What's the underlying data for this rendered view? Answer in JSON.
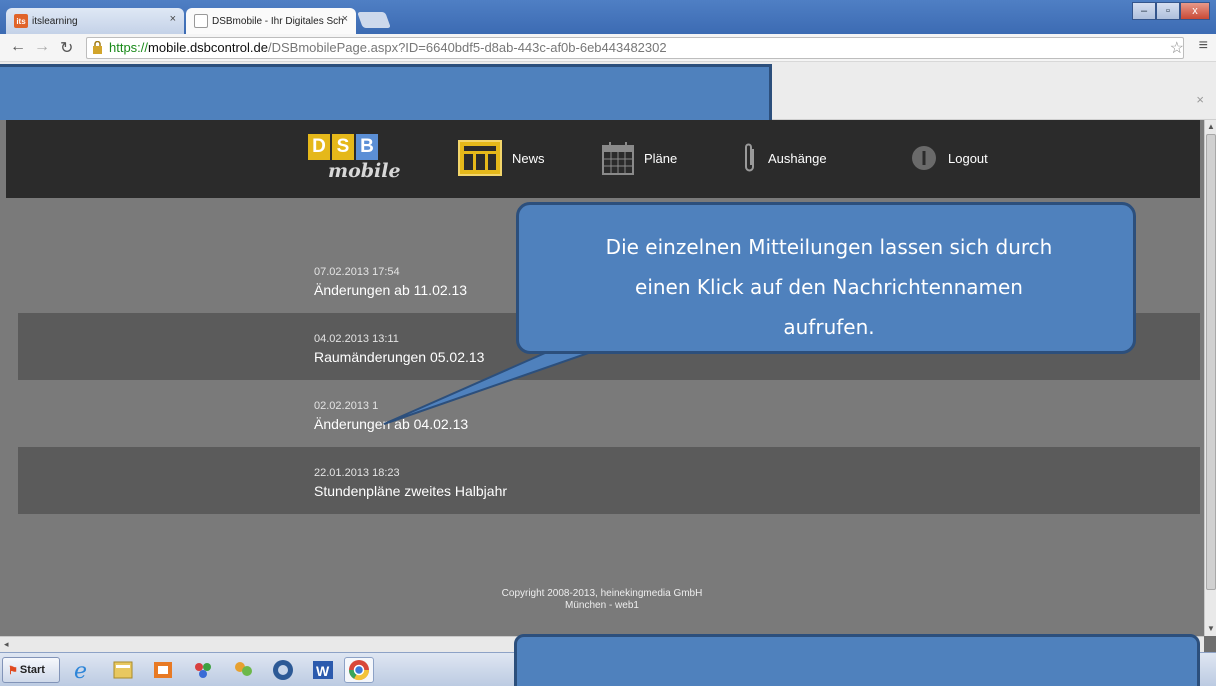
{
  "browser": {
    "tabs": [
      {
        "label": "itslearning",
        "icon": "its-favicon"
      },
      {
        "label": "DSBmobile - Ihr Digitales Sch",
        "icon": "page-favicon"
      }
    ],
    "address": {
      "protocol": "https://",
      "host": "mobile.dsbcontrol.de",
      "path": "/DSBmobilePage.aspx?ID=6640bdf5-d8ab-443c-af0b-6eb443482302"
    }
  },
  "nav": {
    "logo_letters": [
      "D",
      "S",
      "B"
    ],
    "logo_sub": "mobile",
    "items": [
      {
        "label": "News",
        "icon": "news-icon"
      },
      {
        "label": "Pläne",
        "icon": "calendar-icon"
      },
      {
        "label": "Aushänge",
        "icon": "paperclip-icon"
      },
      {
        "label": "Logout",
        "icon": "power-icon"
      }
    ]
  },
  "news": [
    {
      "date": "07.02.2013 17:54",
      "title": "Änderungen ab 11.02.13"
    },
    {
      "date": "04.02.2013 13:11",
      "title": "Raumänderungen 05.02.13"
    },
    {
      "date": "02.02.2013 1",
      "title": "Änderungen ab 04.02.13"
    },
    {
      "date": "22.01.2013 18:23",
      "title": "Stundenpläne zweites Halbjahr"
    }
  ],
  "footer": {
    "line1": "Copyright 2008-2013, heinekingmedia GmbH",
    "line2": "München - web1"
  },
  "callout": {
    "lines": [
      "Die einzelnen Mitteilungen lassen sich durch",
      "einen Klick auf den Nachrichtennamen",
      "aufrufen."
    ]
  },
  "taskbar": {
    "start_label": "Start"
  },
  "colors": {
    "accent": "#4f81bd",
    "accent_border": "#2c4f7c",
    "logo_yellow": "#e5b81a",
    "logo_blue": "#5b8fd6"
  }
}
